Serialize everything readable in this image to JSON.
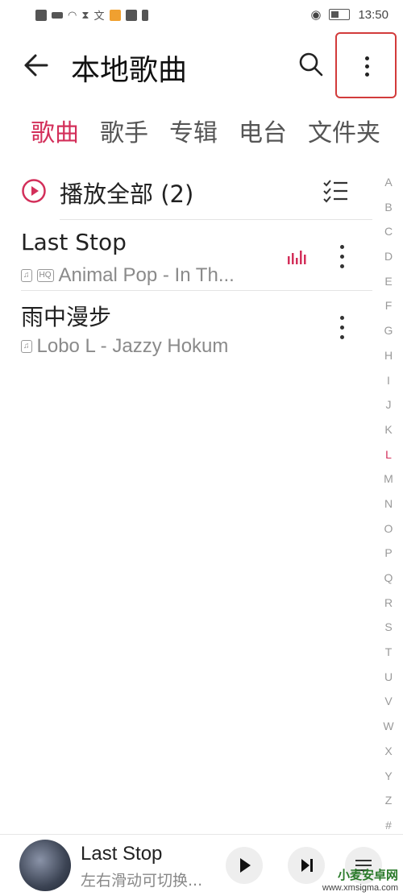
{
  "status_bar": {
    "left_icons": [
      "hd-icon",
      "signal-4g-icon",
      "wifi-icon",
      "hourglass-icon",
      "translate-icon",
      "app-icon",
      "mail-icon",
      "alert-icon"
    ],
    "time": "13:50"
  },
  "header": {
    "title": "本地歌曲",
    "back_icon": "arrow-left-icon",
    "search_icon": "search-icon",
    "more_icon": "more-vertical-icon"
  },
  "tabs": [
    {
      "label": "歌曲",
      "active": true
    },
    {
      "label": "歌手",
      "active": false
    },
    {
      "label": "专辑",
      "active": false
    },
    {
      "label": "电台",
      "active": false
    },
    {
      "label": "文件夹",
      "active": false
    }
  ],
  "play_all": {
    "label": "播放全部 (2)",
    "icon": "play-circle-icon",
    "multi_select_icon": "checklist-icon"
  },
  "songs": [
    {
      "title": "Last Stop",
      "artist_album": "Animal Pop - In Th...",
      "hq": "HQ",
      "playing": true
    },
    {
      "title": "雨中漫步",
      "artist_album": "Lobo L - Jazzy Hokum",
      "hq": "",
      "playing": false
    }
  ],
  "index_letters": [
    "A",
    "B",
    "C",
    "D",
    "E",
    "F",
    "G",
    "H",
    "I",
    "J",
    "K",
    "L",
    "M",
    "N",
    "O",
    "P",
    "Q",
    "R",
    "S",
    "T",
    "U",
    "V",
    "W",
    "X",
    "Y",
    "Z",
    "#"
  ],
  "index_selected": "L",
  "player": {
    "song": "Last Stop",
    "hint": "左右滑动可切换..."
  },
  "watermark": {
    "brand": "小麦安卓网",
    "url": "www.xmsigma.com"
  },
  "colors": {
    "accent": "#d32f5a",
    "highlight_box": "#d23b3b"
  }
}
